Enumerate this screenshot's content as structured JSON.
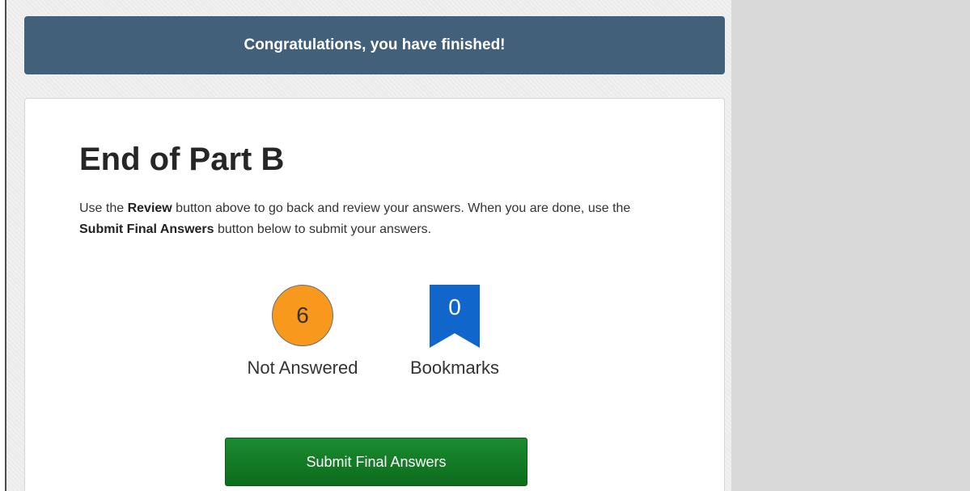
{
  "banner": {
    "message": "Congratulations, you have finished!"
  },
  "card": {
    "title": "End of Part B",
    "instructions": {
      "part1": "Use the ",
      "review_word": "Review",
      "part2": " button above to go back and review your answers. When you are done, use the ",
      "submit_word": "Submit Final Answers",
      "part3": " button below to submit your answers."
    },
    "stats": {
      "not_answered": {
        "count": "6",
        "label": "Not Answered"
      },
      "bookmarks": {
        "count": "0",
        "label": "Bookmarks"
      }
    },
    "submit_button_label": "Submit Final Answers"
  },
  "colors": {
    "banner": "#42607a",
    "not_answered_badge": "#f8991d",
    "bookmark_badge": "#1166cc",
    "submit_button": "#137a26",
    "side_background": "#d9d9d9"
  },
  "icons": {
    "not_answered": "circle-count-icon",
    "bookmarks": "bookmark-icon"
  }
}
